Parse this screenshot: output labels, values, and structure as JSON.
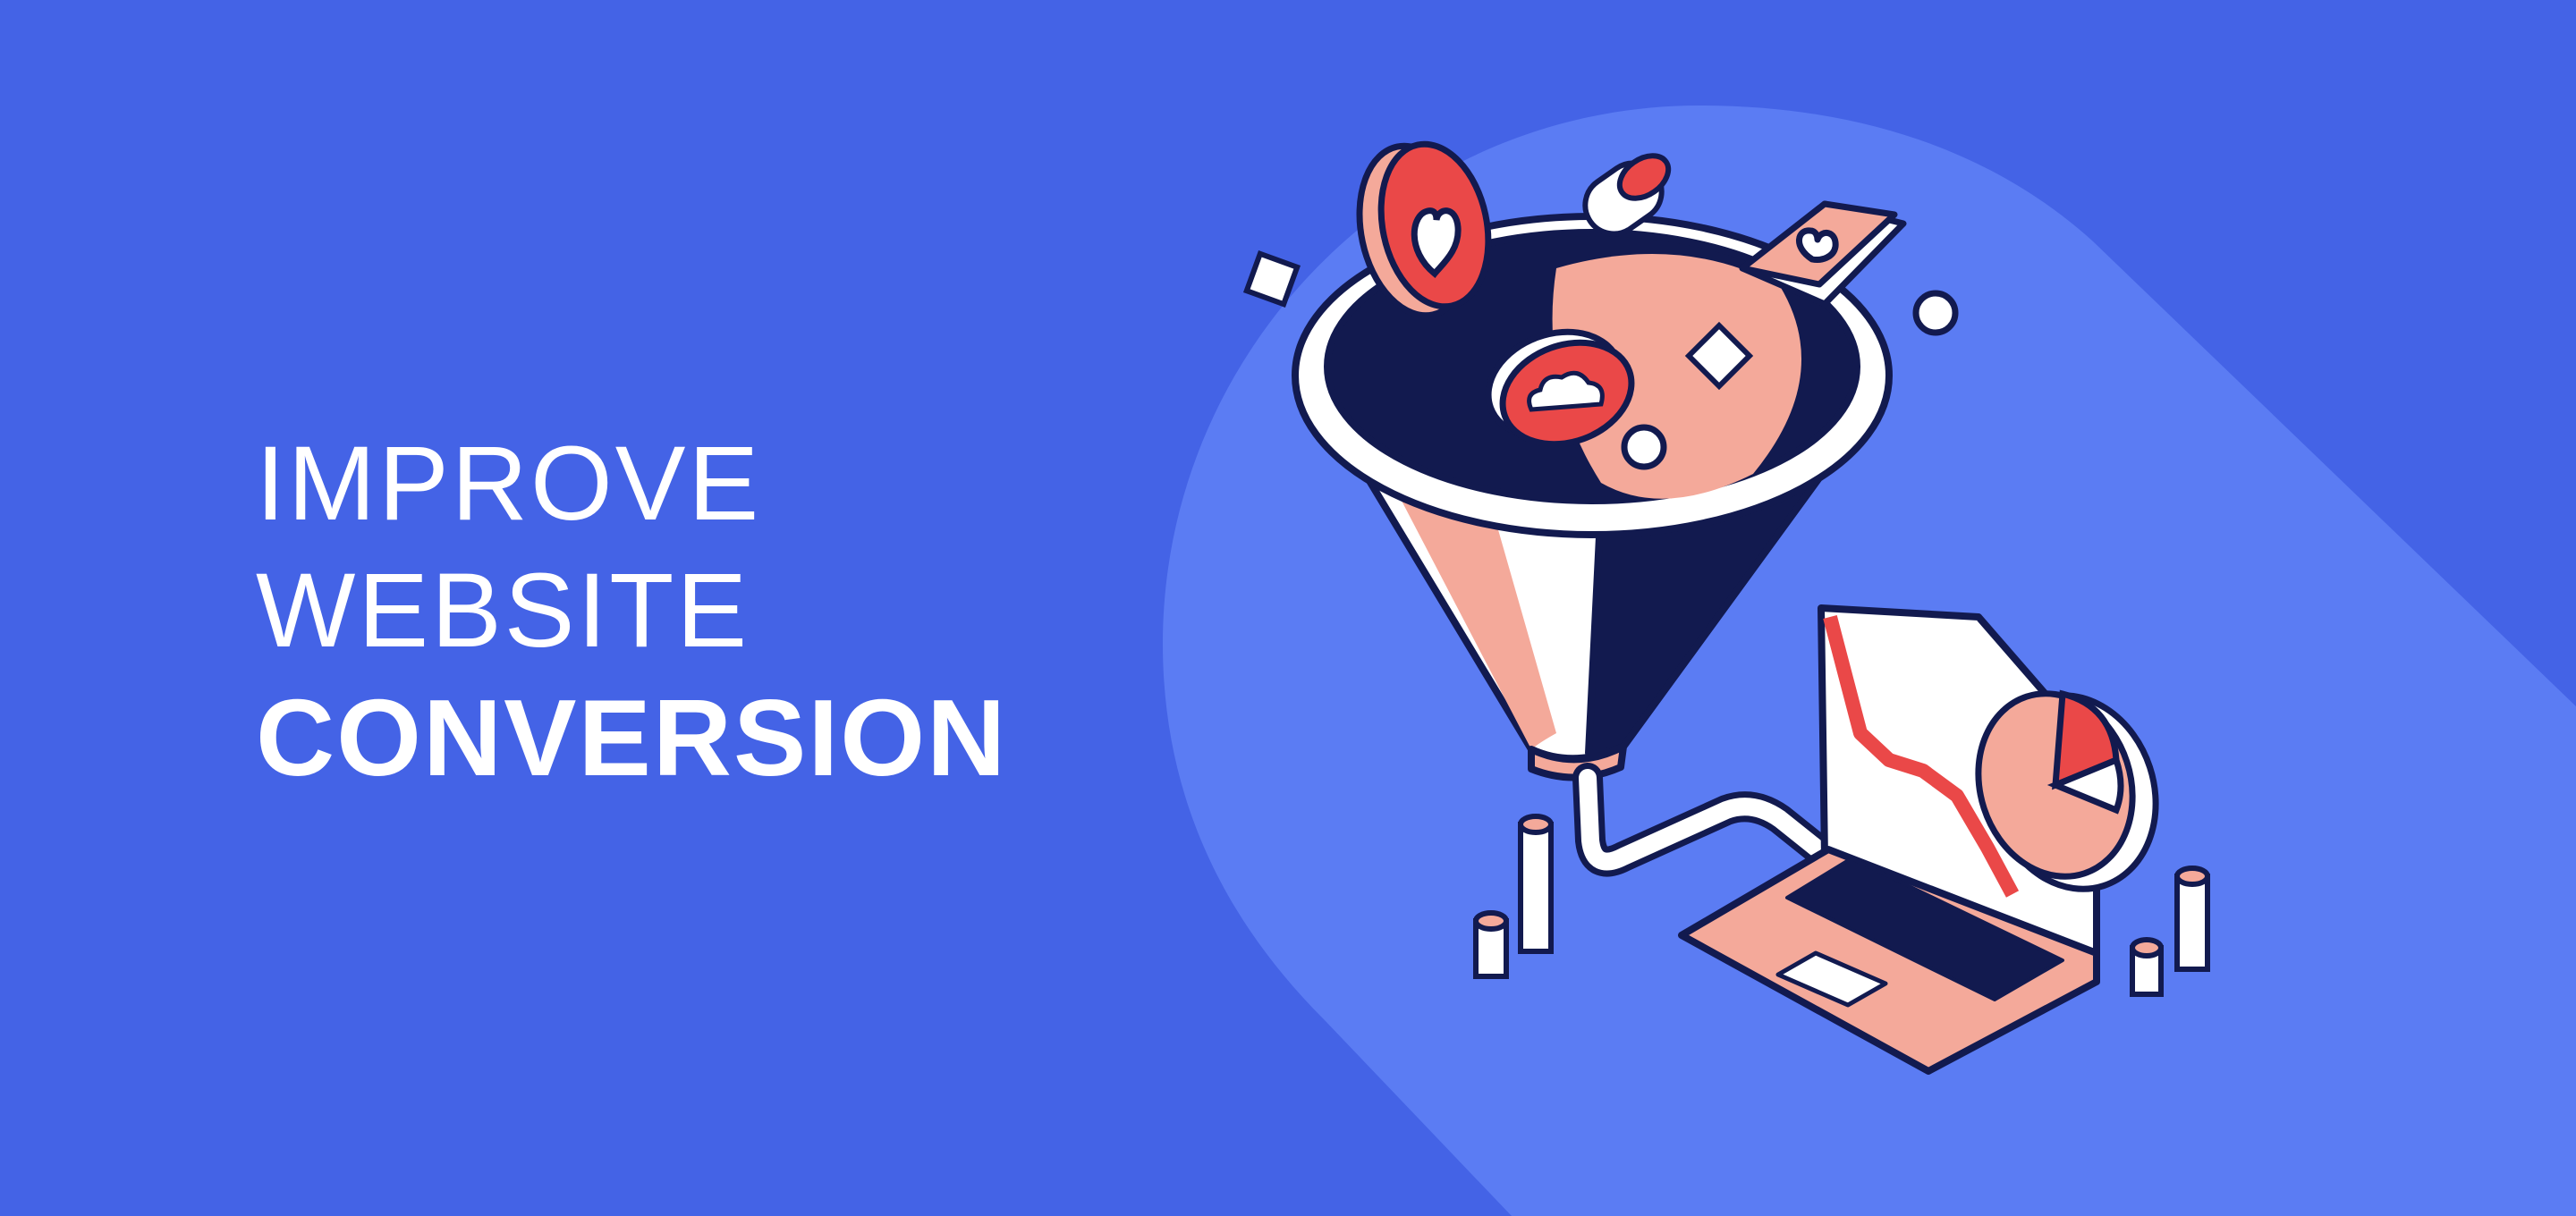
{
  "headline": {
    "line1": "IMPROVE",
    "line2": "WEBSITE",
    "line3": "CONVERSION"
  },
  "colors": {
    "background": "#4463e6",
    "halo": "#5b7cf3",
    "navy": "#121a4f",
    "peach": "#f4a99a",
    "red": "#ea4848",
    "white": "#ffffff"
  },
  "icons": [
    "funnel-icon",
    "heart-icon",
    "cloud-icon",
    "laptop-icon",
    "pie-chart-icon",
    "line-chart-icon"
  ]
}
